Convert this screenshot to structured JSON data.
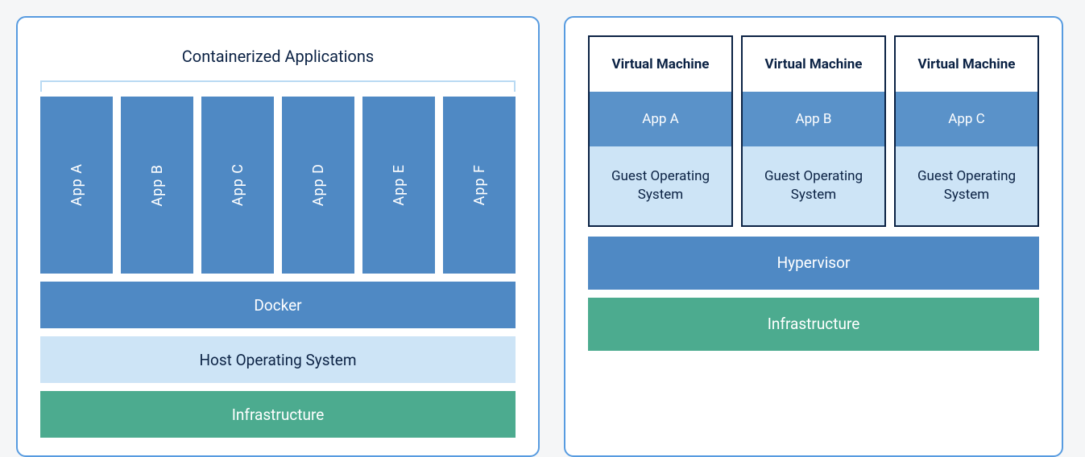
{
  "left": {
    "title": "Containerized Applications",
    "apps": [
      "App A",
      "App B",
      "App C",
      "App D",
      "App E",
      "App F"
    ],
    "docker": "Docker",
    "host_os": "Host Operating System",
    "infra": "Infrastructure"
  },
  "right": {
    "vm_label": "Virtual Machine",
    "vms": [
      {
        "app": "App A",
        "os": "Guest Operating System"
      },
      {
        "app": "App B",
        "os": "Guest Operating System"
      },
      {
        "app": "App C",
        "os": "Guest Operating System"
      }
    ],
    "hypervisor": "Hypervisor",
    "infra": "Infrastructure"
  },
  "colors": {
    "panel_border": "#579be0",
    "blue": "#4f89c4",
    "lightblue": "#cde4f6",
    "green": "#4cab8f",
    "dark": "#0b2244"
  }
}
